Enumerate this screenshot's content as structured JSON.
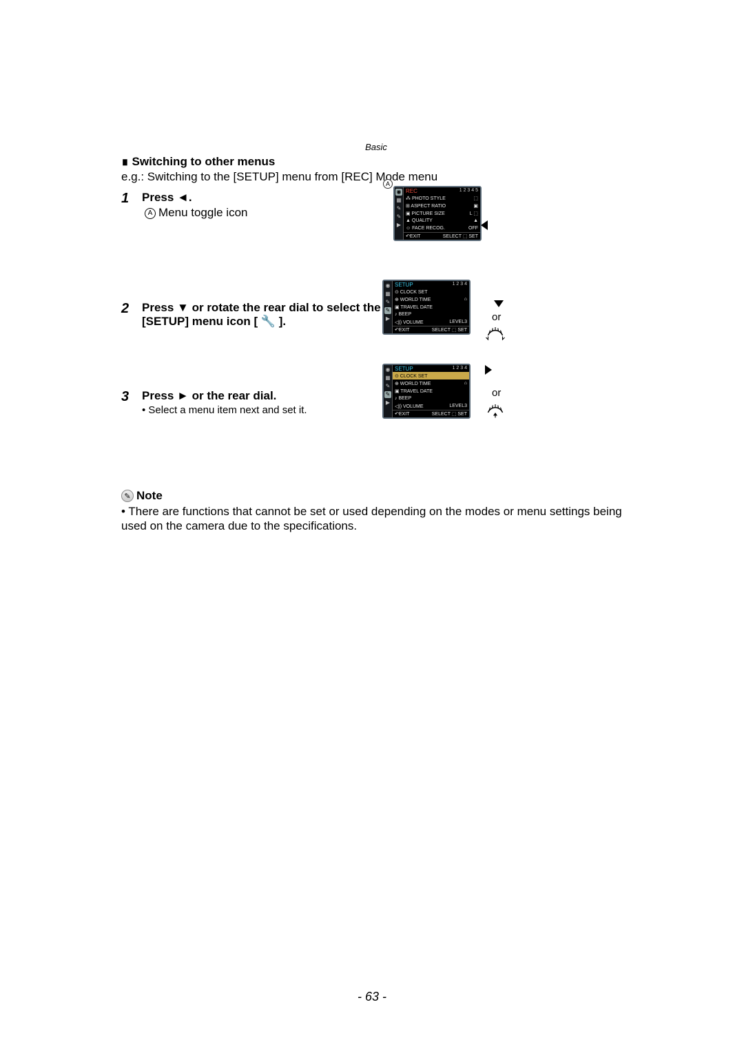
{
  "header": "Basic",
  "section_title": "Switching to other menus",
  "eg_line": "e.g.: Switching to the [SETUP] menu from [REC] Mode menu",
  "step1": {
    "num": "1",
    "bold": "Press ◄.",
    "label_a": "A",
    "desc_a": "Menu toggle icon"
  },
  "step2": {
    "num": "2",
    "bold1": "Press ▼ or rotate the rear dial to select the",
    "bold2": "[SETUP] menu icon [ 🔧 ]."
  },
  "step3": {
    "num": "3",
    "bold": "Press ► or the rear dial.",
    "bullet": "Select a menu item next and set it."
  },
  "note": {
    "label": "Note",
    "text": "There are functions that cannot be set or used depending on the modes or menu settings being used on the camera due to the specifications."
  },
  "page_num": "- 63 -",
  "or_label": "or",
  "screen1": {
    "title": "REC",
    "pages": "1 2 3 4 5",
    "rows": [
      {
        "l": "⁂ PHOTO STYLE",
        "r": "⬚"
      },
      {
        "l": "⊞ ASPECT RATIO",
        "r": "▣"
      },
      {
        "l": "▣ PICTURE SIZE",
        "r": "L ⬚"
      },
      {
        "l": "▲ QUALITY",
        "r": "▲"
      },
      {
        "l": "☺ FACE RECOG.",
        "r": "OFF"
      }
    ],
    "foot_l": "↶EXIT",
    "foot_r": "SELECT ⬚ SET",
    "callout": "A"
  },
  "screen2": {
    "title": "SETUP",
    "pages": "1 2 3 4",
    "rows": [
      {
        "l": "⊙ CLOCK SET",
        "r": ""
      },
      {
        "l": "⊕ WORLD TIME",
        "r": "⌂"
      },
      {
        "l": "▣ TRAVEL DATE",
        "r": ""
      },
      {
        "l": "♪ BEEP",
        "r": ""
      },
      {
        "l": "◁)) VOLUME",
        "r": "LEVEL3"
      }
    ],
    "foot_l": "↶EXIT",
    "foot_r": "SELECT ⬚ SET"
  },
  "screen3": {
    "title": "SETUP",
    "pages": "1 2 3 4",
    "rows": [
      {
        "l": "⊙ CLOCK SET",
        "r": "",
        "sel": true
      },
      {
        "l": "⊕ WORLD TIME",
        "r": "⌂"
      },
      {
        "l": "▣ TRAVEL DATE",
        "r": ""
      },
      {
        "l": "♪ BEEP",
        "r": ""
      },
      {
        "l": "◁)) VOLUME",
        "r": "LEVEL3"
      }
    ],
    "foot_l": "↶EXIT",
    "foot_r": "SELECT ⬚ SET"
  }
}
